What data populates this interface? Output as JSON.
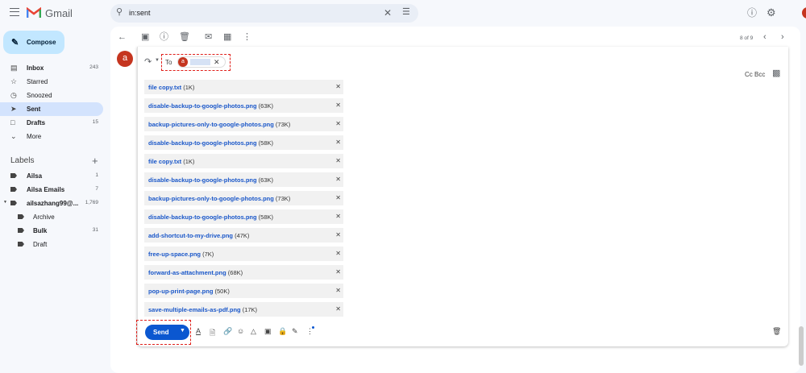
{
  "header": {
    "brand": "Gmail",
    "search_value": "in:sent"
  },
  "sidebar": {
    "compose": "Compose",
    "items": [
      {
        "label": "Inbox",
        "count": "243",
        "icon": "inbox-icon",
        "bold": true
      },
      {
        "label": "Starred",
        "count": "",
        "icon": "star-icon"
      },
      {
        "label": "Snoozed",
        "count": "",
        "icon": "clock-icon"
      },
      {
        "label": "Sent",
        "count": "",
        "icon": "send-icon",
        "bold": true,
        "active": true
      },
      {
        "label": "Drafts",
        "count": "15",
        "icon": "draft-icon",
        "bold": true
      },
      {
        "label": "More",
        "count": "",
        "icon": "chevron-down-icon"
      }
    ],
    "labels_title": "Labels",
    "labels": [
      {
        "label": "Ailsa",
        "count": "1",
        "bold": true
      },
      {
        "label": "Ailsa Emails",
        "count": "7",
        "bold": true
      },
      {
        "label": "ailsazhang99@...",
        "count": "1,769",
        "bold": true
      },
      {
        "label": "Archive",
        "count": "",
        "sub": true
      },
      {
        "label": "Bulk",
        "count": "31",
        "sub": true,
        "bold": true
      },
      {
        "label": "Draft",
        "count": "",
        "sub": true
      }
    ]
  },
  "toolbar": {
    "pagination": "8 of 9"
  },
  "message": {
    "avatar": "a",
    "to_label": "To",
    "recipient_avatar": "a",
    "cc_bcc": "Cc Bcc"
  },
  "attachments": [
    {
      "name": "file copy.txt",
      "size": "(1K)"
    },
    {
      "name": "disable-backup-to-google-photos.png",
      "size": "(63K)"
    },
    {
      "name": "backup-pictures-only-to-google-photos.png",
      "size": "(73K)"
    },
    {
      "name": "disable-backup-to-google-photos.png",
      "size": "(58K)"
    },
    {
      "name": "file copy.txt",
      "size": "(1K)"
    },
    {
      "name": "disable-backup-to-google-photos.png",
      "size": "(63K)"
    },
    {
      "name": "backup-pictures-only-to-google-photos.png",
      "size": "(73K)"
    },
    {
      "name": "disable-backup-to-google-photos.png",
      "size": "(58K)"
    },
    {
      "name": "add-shortcut-to-my-drive.png",
      "size": "(47K)"
    },
    {
      "name": "free-up-space.png",
      "size": "(7K)"
    },
    {
      "name": "forward-as-attachment.png",
      "size": "(68K)"
    },
    {
      "name": "pop-up-print-page.png",
      "size": "(50K)"
    },
    {
      "name": "save-multiple-emails-as-pdf.png",
      "size": "(17K)"
    }
  ],
  "compose": {
    "send": "Send"
  },
  "colors": {
    "accent": "#0b57d0",
    "highlight": "#e0201b"
  }
}
